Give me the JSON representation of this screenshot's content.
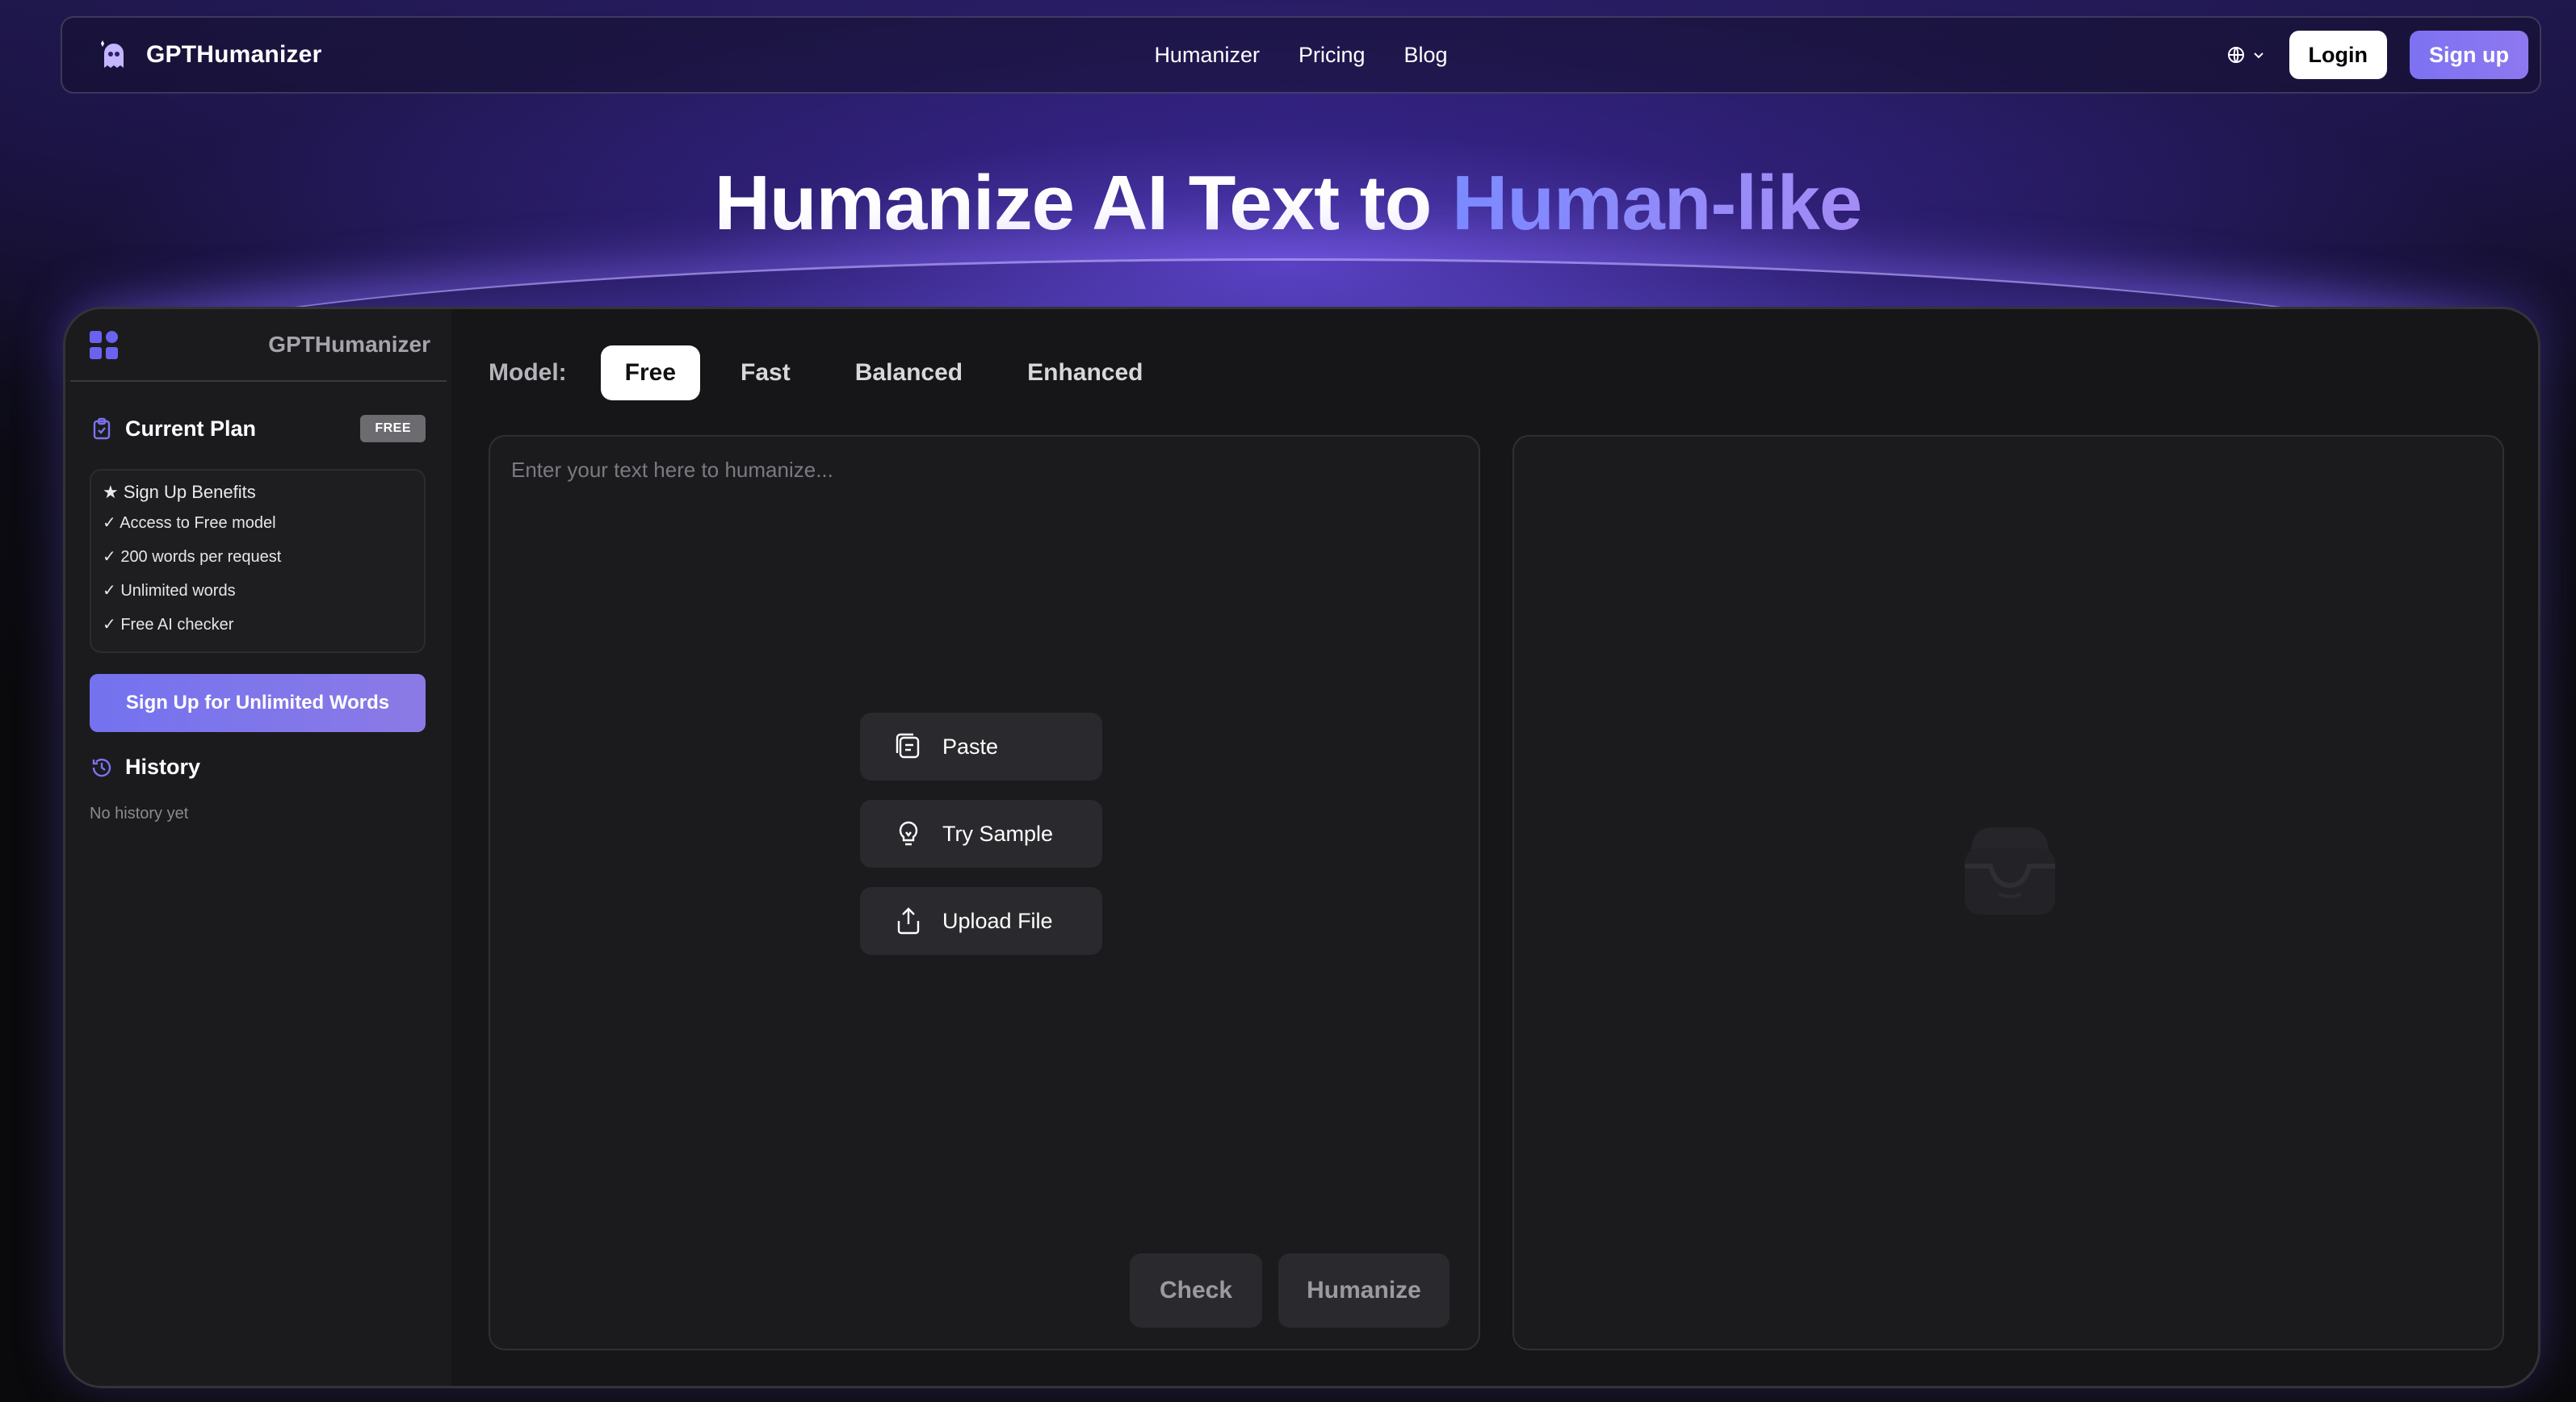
{
  "nav": {
    "brand": "GPTHumanizer",
    "links": [
      "Humanizer",
      "Pricing",
      "Blog"
    ],
    "login": "Login",
    "signup": "Sign up",
    "language_icon": "globe-icon"
  },
  "hero": {
    "title_main": "Humanize AI Text to ",
    "title_accent": "Human-like"
  },
  "sidebar": {
    "brand": "GPTHumanizer",
    "plan_title": "Current Plan",
    "plan_badge": "FREE",
    "benefits_title": "★ Sign Up Benefits",
    "benefits": [
      "✓  Access to Free model",
      "✓  200 words per request",
      "✓  Unlimited words",
      "✓  Free AI checker"
    ],
    "cta": "Sign Up for Unlimited Words",
    "history_title": "History",
    "history_empty": "No history yet"
  },
  "editor": {
    "model_label": "Model:",
    "models": [
      "Free",
      "Fast",
      "Balanced",
      "Enhanced"
    ],
    "active_model": "Free",
    "placeholder": "Enter your text here to humanize...",
    "actions": {
      "paste": "Paste",
      "sample": "Try Sample",
      "upload": "Upload File"
    },
    "check": "Check",
    "humanize": "Humanize"
  },
  "colors": {
    "accent": "#7b72f0",
    "background": "#0a0a0c",
    "panel": "#1b1b1e"
  }
}
